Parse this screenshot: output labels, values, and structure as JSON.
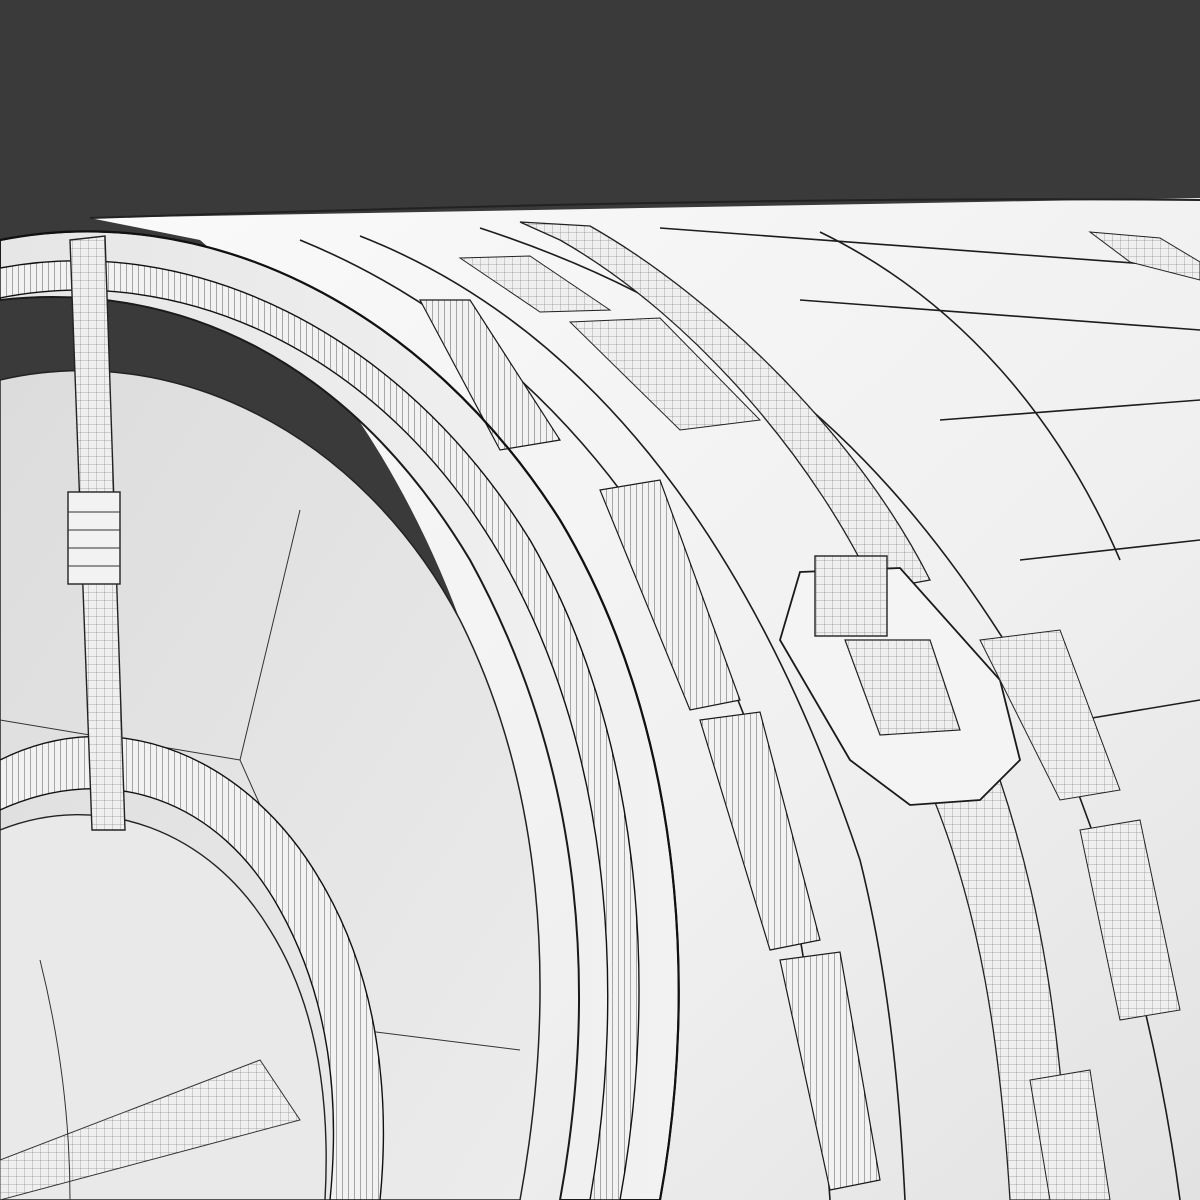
{
  "scene": {
    "subject": "wireframe-render-cylinder",
    "colors": {
      "background": "#3a3a3a",
      "surface_light": "#f2f2f2",
      "surface_mid": "#e4e4e4",
      "surface_shadow": "#cfcfcf",
      "wire": "#1a1a1a",
      "wire_fine": "#555555"
    }
  }
}
